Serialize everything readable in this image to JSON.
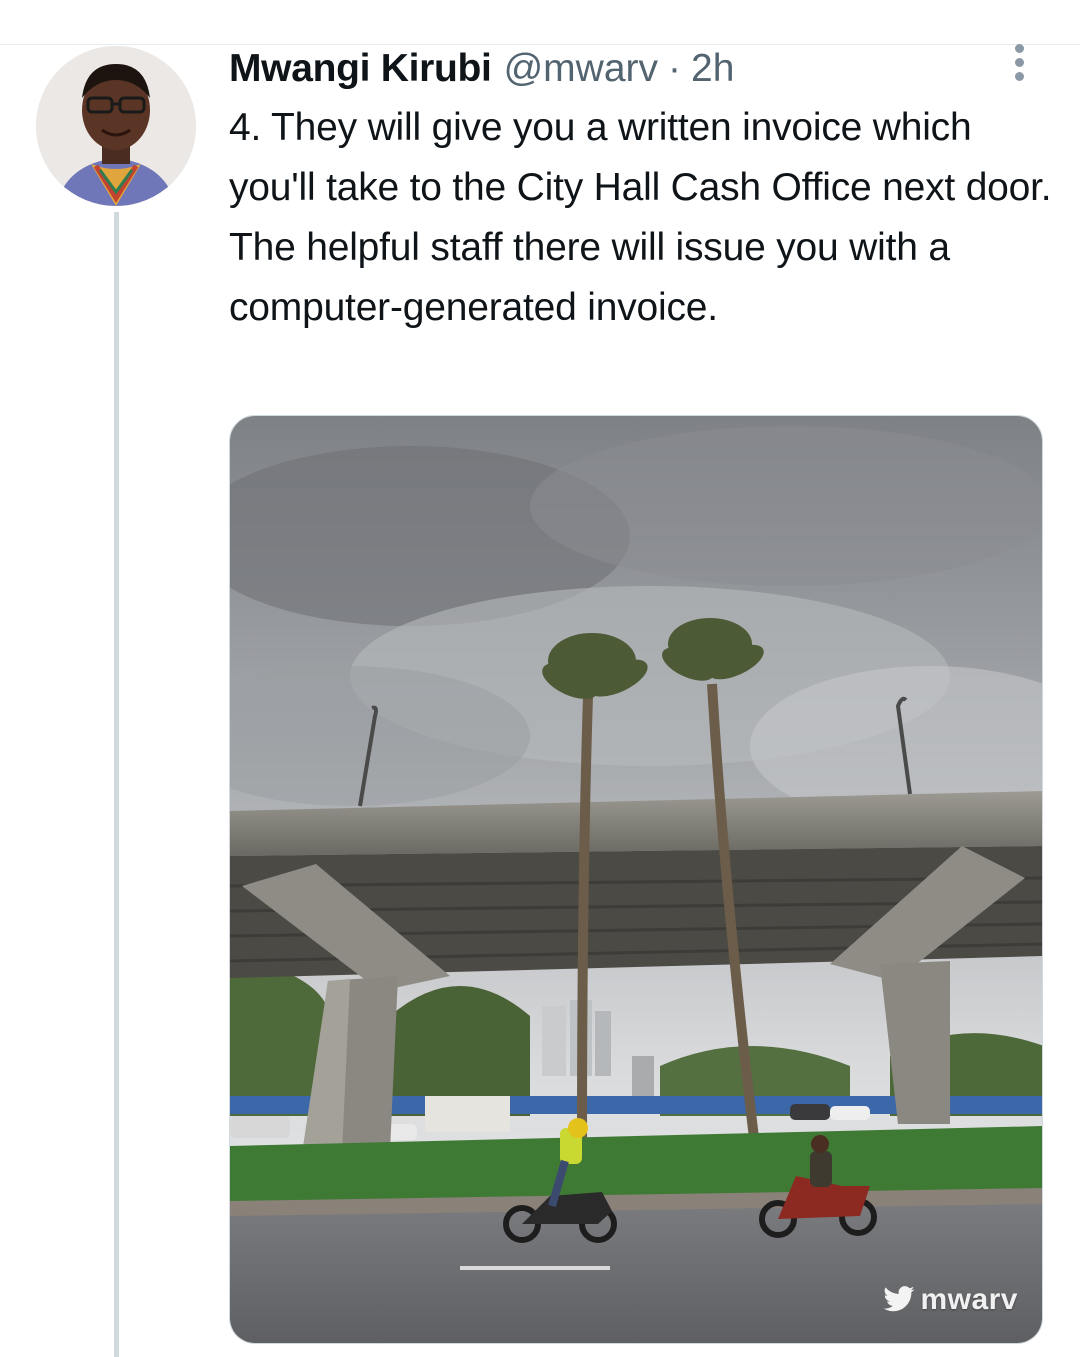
{
  "tweet": {
    "author": {
      "display_name": "Mwangi Kirubi",
      "handle": "@mwarv",
      "separator": "·",
      "timestamp": "2h"
    },
    "text": "4. They will give you a written invoice which you'll take to the City Hall Cash Office next door. The helpful staff there will issue you with a computer-generated invoice.",
    "media": {
      "watermark_handle": "mwarv"
    }
  },
  "icons": [
    "more-options-icon",
    "twitter-bird-icon"
  ],
  "colors": {
    "text_primary": "#0f1419",
    "text_secondary": "#536471",
    "thread_line": "#cfd9de",
    "divider": "#e6ecf0"
  }
}
